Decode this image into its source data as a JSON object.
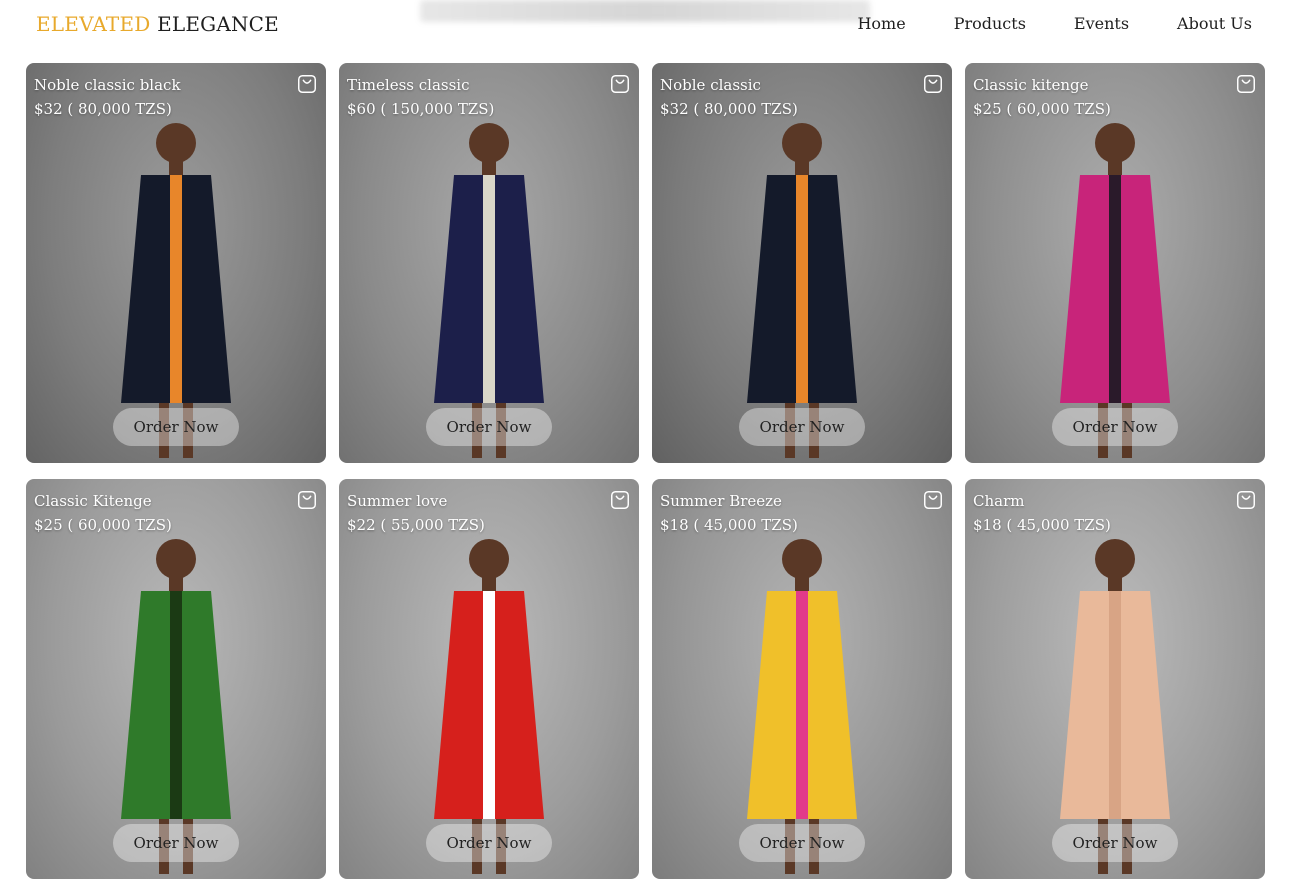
{
  "brand": {
    "part1": "ELEVATED",
    "part2": "ELEGANCE",
    "accent": "#e8a92c"
  },
  "nav": [
    "Home",
    "Products",
    "Events",
    "About Us"
  ],
  "products": [
    {
      "name": "Noble classic black",
      "price": "$32 ( 80,000 TZS)",
      "order": "Order Now",
      "icon": "shopping-bag-icon",
      "bg": "#7d7d7d",
      "outfit": "#141a2a",
      "accent": "#e8862a"
    },
    {
      "name": "Timeless classic",
      "price": "$60 ( 150,000 TZS)",
      "order": "Order Now",
      "icon": "shopping-bag-icon",
      "bg": "#8a8a8a",
      "outfit": "#1c1f4a",
      "accent": "#d9d6c8"
    },
    {
      "name": "Noble classic",
      "price": "$32 ( 80,000 TZS)",
      "order": "Order Now",
      "icon": "shopping-bag-icon",
      "bg": "#7a7a7a",
      "outfit": "#141a2a",
      "accent": "#e8862a"
    },
    {
      "name": "Classic kitenge",
      "price": "$25 ( 60,000 TZS)",
      "order": "Order Now",
      "icon": "shopping-bag-icon",
      "bg": "#8e8e8e",
      "outfit": "#c8247a",
      "accent": "#2a1a2a"
    },
    {
      "name": "Classic Kitenge",
      "price": "$25 ( 60,000 TZS)",
      "order": "Order Now",
      "icon": "shopping-bag-icon",
      "bg": "#9a9a9a",
      "outfit": "#2f7a2a",
      "accent": "#1b3a14"
    },
    {
      "name": "Summer love",
      "price": "$22 ( 55,000 TZS)",
      "order": "Order Now",
      "icon": "shopping-bag-icon",
      "bg": "#9c9c9c",
      "outfit": "#d6201c",
      "accent": "#ffffff"
    },
    {
      "name": "Summer Breeze",
      "price": "$18 ( 45,000 TZS)",
      "order": "Order Now",
      "icon": "shopping-bag-icon",
      "bg": "#959595",
      "outfit": "#f0c02a",
      "accent": "#e23a8a"
    },
    {
      "name": "Charm",
      "price": "$18 ( 45,000 TZS)",
      "order": "Order Now",
      "icon": "shopping-bag-icon",
      "bg": "#9d9d9d",
      "outfit": "#e9b99a",
      "accent": "#d8a485"
    }
  ]
}
